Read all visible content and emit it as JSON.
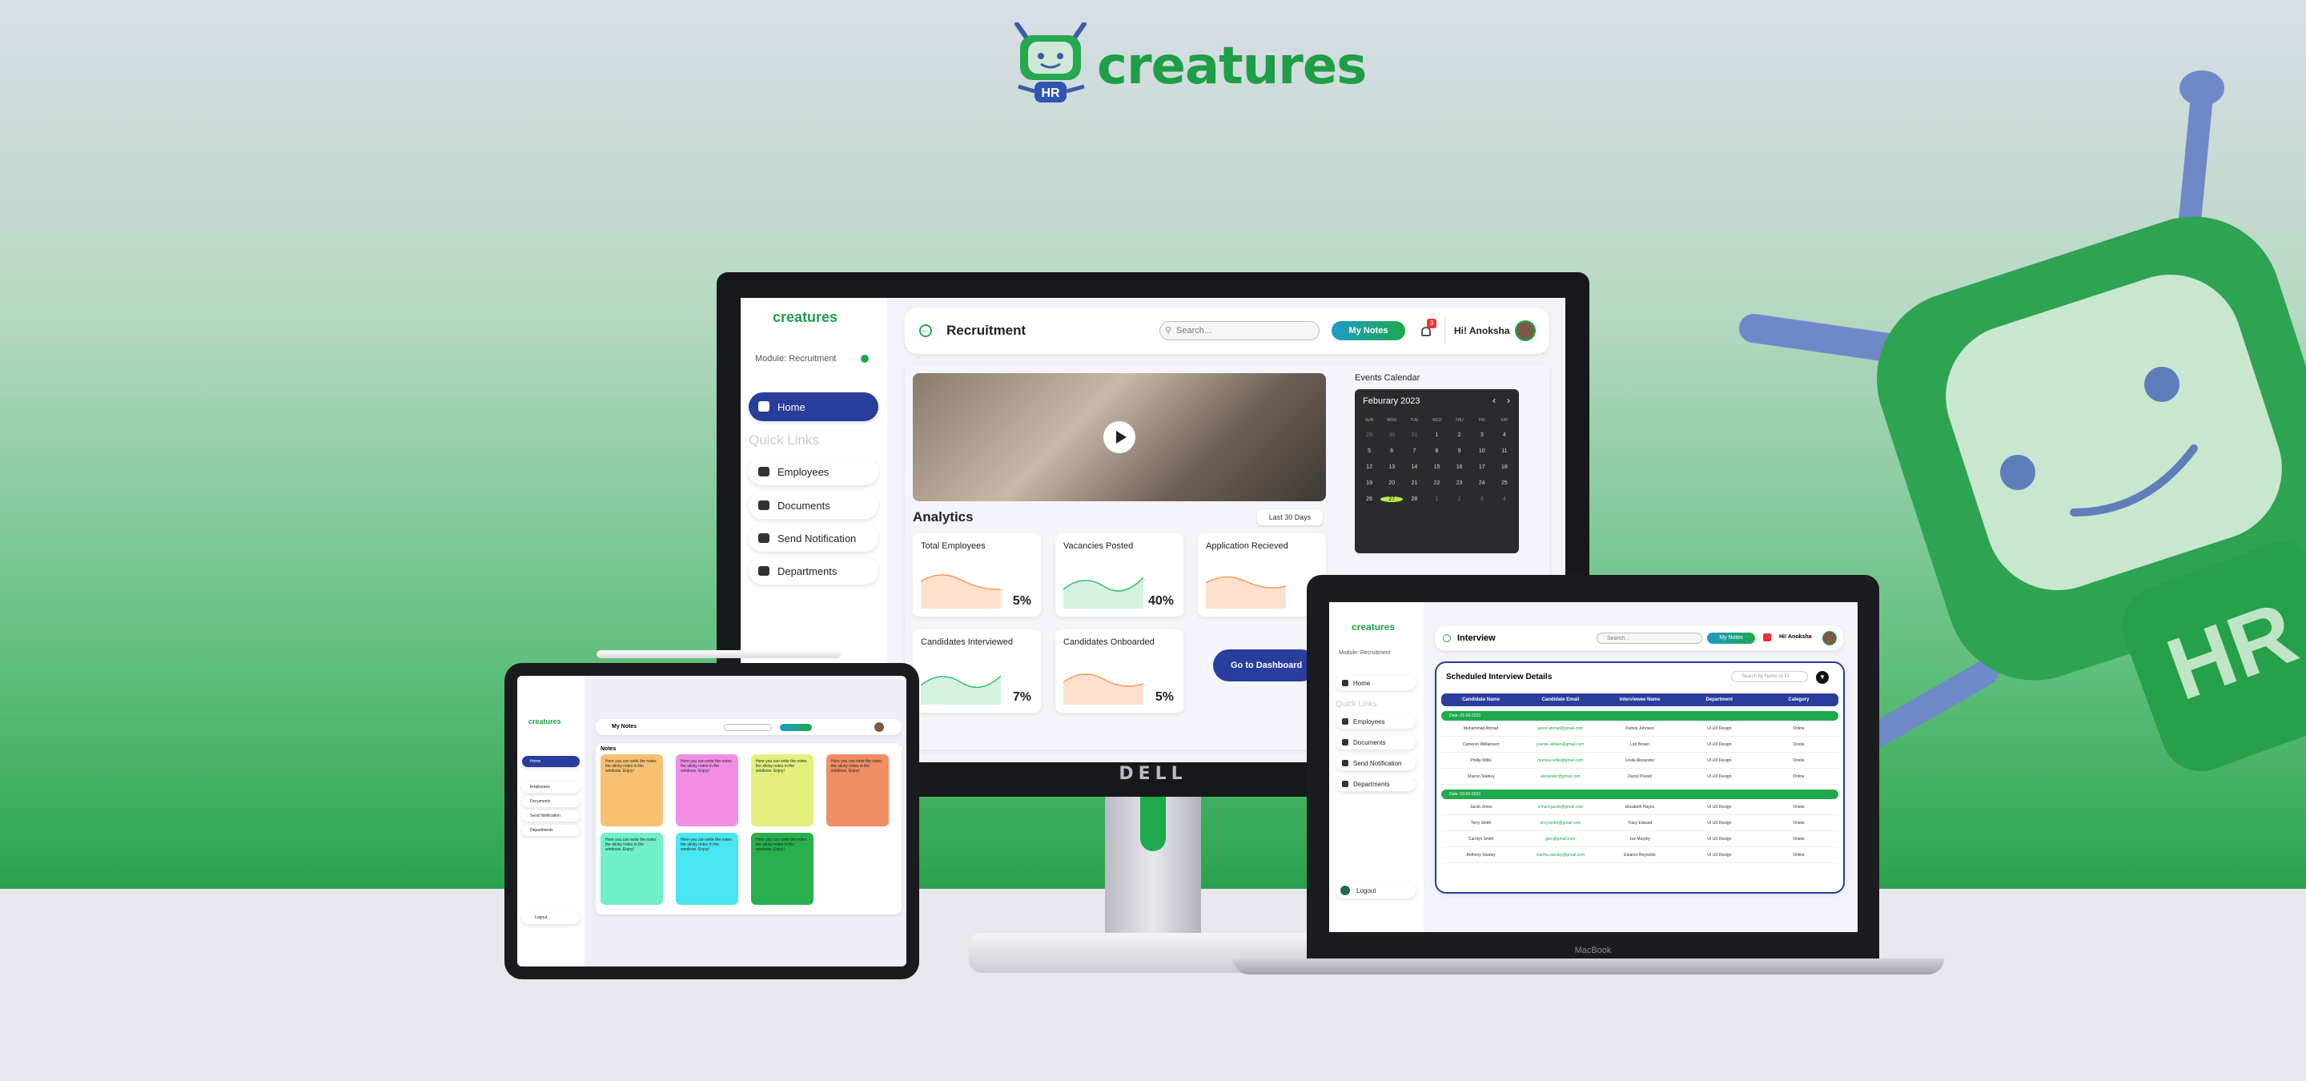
{
  "brand": {
    "name": "creatures",
    "badge": "HR"
  },
  "colors": {
    "green": "#1e9e46",
    "navy": "#283d9c",
    "teal": "#16b8a6"
  },
  "monitor": {
    "label": "DELL",
    "logo": "creatures",
    "module": "Module: Recruitment",
    "nav_home": "Home",
    "quick_links": "Quick Links",
    "links": [
      "Employees",
      "Documents",
      "Send Notification",
      "Departments"
    ],
    "page_title": "Recruitment",
    "search_placeholder": "Search...",
    "my_notes": "My Notes",
    "notif_count": "3",
    "greeting": "Hi! Anoksha",
    "analytics_title": "Analytics",
    "filter": "Last 30 Days",
    "cards": [
      {
        "title": "Total Employees",
        "value": "5%"
      },
      {
        "title": "Vacancies Posted",
        "value": "40%"
      },
      {
        "title": "Application Recieved",
        "value": ""
      },
      {
        "title": "Candidates Interviewed",
        "value": "7%"
      },
      {
        "title": "Candidates Onboarded",
        "value": "5%"
      }
    ],
    "dashboard_btn": "Go to Dashboard",
    "calendar_title": "Events Calendar",
    "calendar_month": "Feburary 2023",
    "weekdays": [
      "SUN",
      "MON",
      "TUE",
      "WED",
      "THU",
      "FRI",
      "SAT"
    ],
    "days": [
      "29",
      "30",
      "31",
      "1",
      "2",
      "3",
      "4",
      "5",
      "6",
      "7",
      "8",
      "9",
      "10",
      "11",
      "12",
      "13",
      "14",
      "15",
      "16",
      "17",
      "18",
      "19",
      "20",
      "21",
      "22",
      "23",
      "24",
      "25",
      "26",
      "27",
      "28",
      "1",
      "2",
      "3",
      "4"
    ]
  },
  "tablet": {
    "logo": "creatures",
    "page_title": "My Notes",
    "notes_title": "Notes",
    "nav": [
      "Home",
      "Employees",
      "Documents",
      "Send Notification",
      "Departments"
    ],
    "logout": "Logout",
    "note_text": "Here you can write the notes the sticky notes in the windows. Enjoy!"
  },
  "laptop": {
    "label": "MacBook",
    "logo": "creatures",
    "module": "Module: Recruitment",
    "page_title": "Interview",
    "search_placeholder": "Search...",
    "my_notes": "My Notes",
    "greeting": "Hi! Anoksha",
    "nav_home": "Home",
    "quick_links": "Quick Links",
    "links": [
      "Employees",
      "Documents",
      "Send Notification",
      "Departments"
    ],
    "logout": "Logout",
    "table_title": "Scheduled Interview Details",
    "table_search": "Search by Name or ID",
    "columns": [
      "Candidate Name",
      "Candidate Email",
      "Interviewee Name",
      "Department",
      "Category"
    ],
    "groups": [
      {
        "date": "Date: 01-03-2023",
        "rows": [
          [
            "Muhammad Ahmad",
            "jason.ahmad@gmail.com",
            "Patrick Johnson",
            "UI UX Design",
            "Online"
          ],
          [
            "Cameron Williamson",
            "joanne.william@gmail.com",
            "Lori Brown",
            "UI UX Design",
            "Onsite"
          ],
          [
            "Phillip Willis",
            "marissa.willis@gmail.com",
            "Leslie Alexander",
            "UI UX Design",
            "Onsite"
          ],
          [
            "Sharon Stanley",
            "alexander@gmail.com",
            "Darryl Powell",
            "UI UX Design",
            "Online"
          ]
        ]
      },
      {
        "date": "Date: 03-03-2023",
        "rows": [
          [
            "Jacob Jones",
            "richard.jacob@gmail.com",
            "Elizabeth Hayes",
            "UI UX Design",
            "Onsite"
          ],
          [
            "Terry Smith",
            "terry.smith@gmail.com",
            "Tracy Edward",
            "UI UX Design",
            "Onsite"
          ],
          [
            "Carolyn Smith",
            "glen@gmail.com",
            "Joe Murphy",
            "UI UX Design",
            "Onsite"
          ],
          [
            "Anthony Stanley",
            "martha.stanley@gmail.com",
            "Eleanor Reynolds",
            "UI UX Design",
            "Online"
          ]
        ]
      }
    ]
  }
}
